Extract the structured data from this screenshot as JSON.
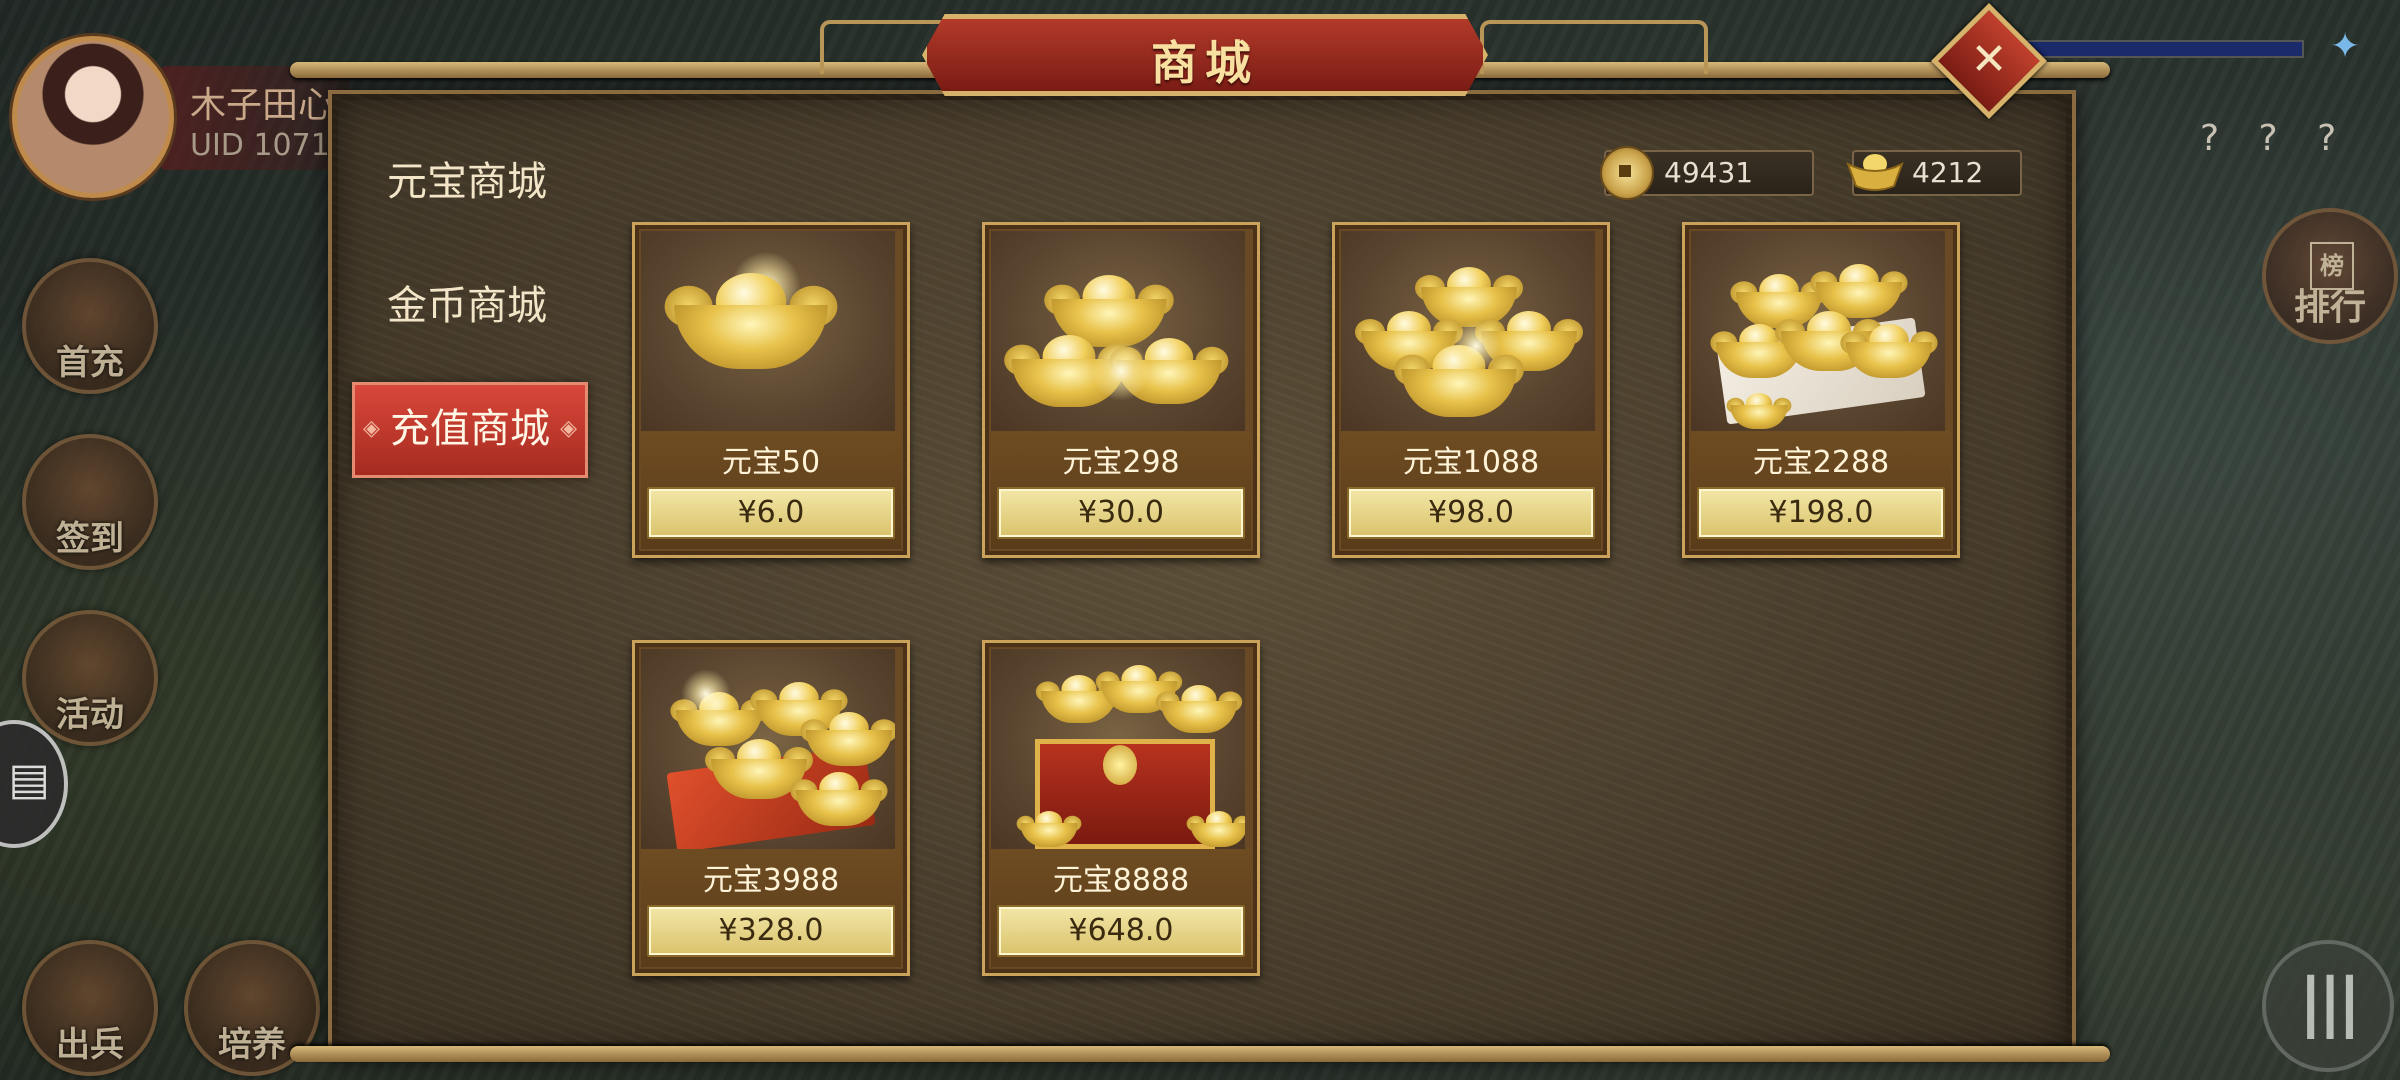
{
  "player": {
    "name": "木子田心",
    "uid": "UID   1071"
  },
  "side_menu": [
    "首充",
    "签到",
    "活动",
    "出兵",
    "培养"
  ],
  "right_menu": {
    "rank_label": "排行",
    "rank_glyph": "榜",
    "question_marks": "? ? ?"
  },
  "dialog": {
    "title": "商城",
    "close_icon": "close-icon",
    "currency": {
      "coin": "49431",
      "ingot": "4212"
    },
    "tabs": [
      {
        "label": "元宝商城",
        "active": false
      },
      {
        "label": "金币商城",
        "active": false
      },
      {
        "label": "充值商城",
        "active": true
      }
    ],
    "products": [
      {
        "name": "元宝50",
        "price": "¥6.0",
        "icon": "single-ingot"
      },
      {
        "name": "元宝298",
        "price": "¥30.0",
        "icon": "three-ingots"
      },
      {
        "name": "元宝1088",
        "price": "¥98.0",
        "icon": "ingot-pile"
      },
      {
        "name": "元宝2288",
        "price": "¥198.0",
        "icon": "ingots-on-cloth"
      },
      {
        "name": "元宝3988",
        "price": "¥328.0",
        "icon": "ingots-on-red-cloth"
      },
      {
        "name": "元宝8888",
        "price": "¥648.0",
        "icon": "treasure-chest"
      }
    ]
  },
  "colors": {
    "accent_red": "#b23a2a",
    "gold": "#d6b26a",
    "panel": "#4a3f2d"
  }
}
